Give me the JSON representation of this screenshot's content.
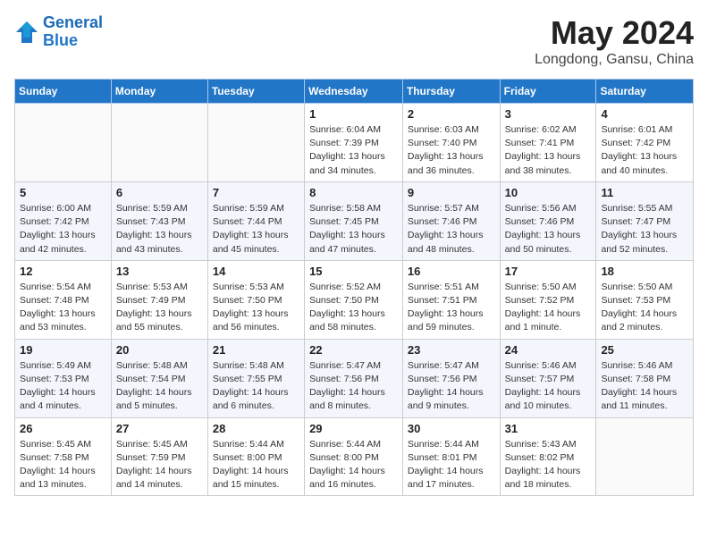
{
  "header": {
    "logo_line1": "General",
    "logo_line2": "Blue",
    "month": "May 2024",
    "location": "Longdong, Gansu, China"
  },
  "weekdays": [
    "Sunday",
    "Monday",
    "Tuesday",
    "Wednesday",
    "Thursday",
    "Friday",
    "Saturday"
  ],
  "weeks": [
    [
      {
        "day": "",
        "info": ""
      },
      {
        "day": "",
        "info": ""
      },
      {
        "day": "",
        "info": ""
      },
      {
        "day": "1",
        "info": "Sunrise: 6:04 AM\nSunset: 7:39 PM\nDaylight: 13 hours\nand 34 minutes."
      },
      {
        "day": "2",
        "info": "Sunrise: 6:03 AM\nSunset: 7:40 PM\nDaylight: 13 hours\nand 36 minutes."
      },
      {
        "day": "3",
        "info": "Sunrise: 6:02 AM\nSunset: 7:41 PM\nDaylight: 13 hours\nand 38 minutes."
      },
      {
        "day": "4",
        "info": "Sunrise: 6:01 AM\nSunset: 7:42 PM\nDaylight: 13 hours\nand 40 minutes."
      }
    ],
    [
      {
        "day": "5",
        "info": "Sunrise: 6:00 AM\nSunset: 7:42 PM\nDaylight: 13 hours\nand 42 minutes."
      },
      {
        "day": "6",
        "info": "Sunrise: 5:59 AM\nSunset: 7:43 PM\nDaylight: 13 hours\nand 43 minutes."
      },
      {
        "day": "7",
        "info": "Sunrise: 5:59 AM\nSunset: 7:44 PM\nDaylight: 13 hours\nand 45 minutes."
      },
      {
        "day": "8",
        "info": "Sunrise: 5:58 AM\nSunset: 7:45 PM\nDaylight: 13 hours\nand 47 minutes."
      },
      {
        "day": "9",
        "info": "Sunrise: 5:57 AM\nSunset: 7:46 PM\nDaylight: 13 hours\nand 48 minutes."
      },
      {
        "day": "10",
        "info": "Sunrise: 5:56 AM\nSunset: 7:46 PM\nDaylight: 13 hours\nand 50 minutes."
      },
      {
        "day": "11",
        "info": "Sunrise: 5:55 AM\nSunset: 7:47 PM\nDaylight: 13 hours\nand 52 minutes."
      }
    ],
    [
      {
        "day": "12",
        "info": "Sunrise: 5:54 AM\nSunset: 7:48 PM\nDaylight: 13 hours\nand 53 minutes."
      },
      {
        "day": "13",
        "info": "Sunrise: 5:53 AM\nSunset: 7:49 PM\nDaylight: 13 hours\nand 55 minutes."
      },
      {
        "day": "14",
        "info": "Sunrise: 5:53 AM\nSunset: 7:50 PM\nDaylight: 13 hours\nand 56 minutes."
      },
      {
        "day": "15",
        "info": "Sunrise: 5:52 AM\nSunset: 7:50 PM\nDaylight: 13 hours\nand 58 minutes."
      },
      {
        "day": "16",
        "info": "Sunrise: 5:51 AM\nSunset: 7:51 PM\nDaylight: 13 hours\nand 59 minutes."
      },
      {
        "day": "17",
        "info": "Sunrise: 5:50 AM\nSunset: 7:52 PM\nDaylight: 14 hours\nand 1 minute."
      },
      {
        "day": "18",
        "info": "Sunrise: 5:50 AM\nSunset: 7:53 PM\nDaylight: 14 hours\nand 2 minutes."
      }
    ],
    [
      {
        "day": "19",
        "info": "Sunrise: 5:49 AM\nSunset: 7:53 PM\nDaylight: 14 hours\nand 4 minutes."
      },
      {
        "day": "20",
        "info": "Sunrise: 5:48 AM\nSunset: 7:54 PM\nDaylight: 14 hours\nand 5 minutes."
      },
      {
        "day": "21",
        "info": "Sunrise: 5:48 AM\nSunset: 7:55 PM\nDaylight: 14 hours\nand 6 minutes."
      },
      {
        "day": "22",
        "info": "Sunrise: 5:47 AM\nSunset: 7:56 PM\nDaylight: 14 hours\nand 8 minutes."
      },
      {
        "day": "23",
        "info": "Sunrise: 5:47 AM\nSunset: 7:56 PM\nDaylight: 14 hours\nand 9 minutes."
      },
      {
        "day": "24",
        "info": "Sunrise: 5:46 AM\nSunset: 7:57 PM\nDaylight: 14 hours\nand 10 minutes."
      },
      {
        "day": "25",
        "info": "Sunrise: 5:46 AM\nSunset: 7:58 PM\nDaylight: 14 hours\nand 11 minutes."
      }
    ],
    [
      {
        "day": "26",
        "info": "Sunrise: 5:45 AM\nSunset: 7:58 PM\nDaylight: 14 hours\nand 13 minutes."
      },
      {
        "day": "27",
        "info": "Sunrise: 5:45 AM\nSunset: 7:59 PM\nDaylight: 14 hours\nand 14 minutes."
      },
      {
        "day": "28",
        "info": "Sunrise: 5:44 AM\nSunset: 8:00 PM\nDaylight: 14 hours\nand 15 minutes."
      },
      {
        "day": "29",
        "info": "Sunrise: 5:44 AM\nSunset: 8:00 PM\nDaylight: 14 hours\nand 16 minutes."
      },
      {
        "day": "30",
        "info": "Sunrise: 5:44 AM\nSunset: 8:01 PM\nDaylight: 14 hours\nand 17 minutes."
      },
      {
        "day": "31",
        "info": "Sunrise: 5:43 AM\nSunset: 8:02 PM\nDaylight: 14 hours\nand 18 minutes."
      },
      {
        "day": "",
        "info": ""
      }
    ]
  ]
}
